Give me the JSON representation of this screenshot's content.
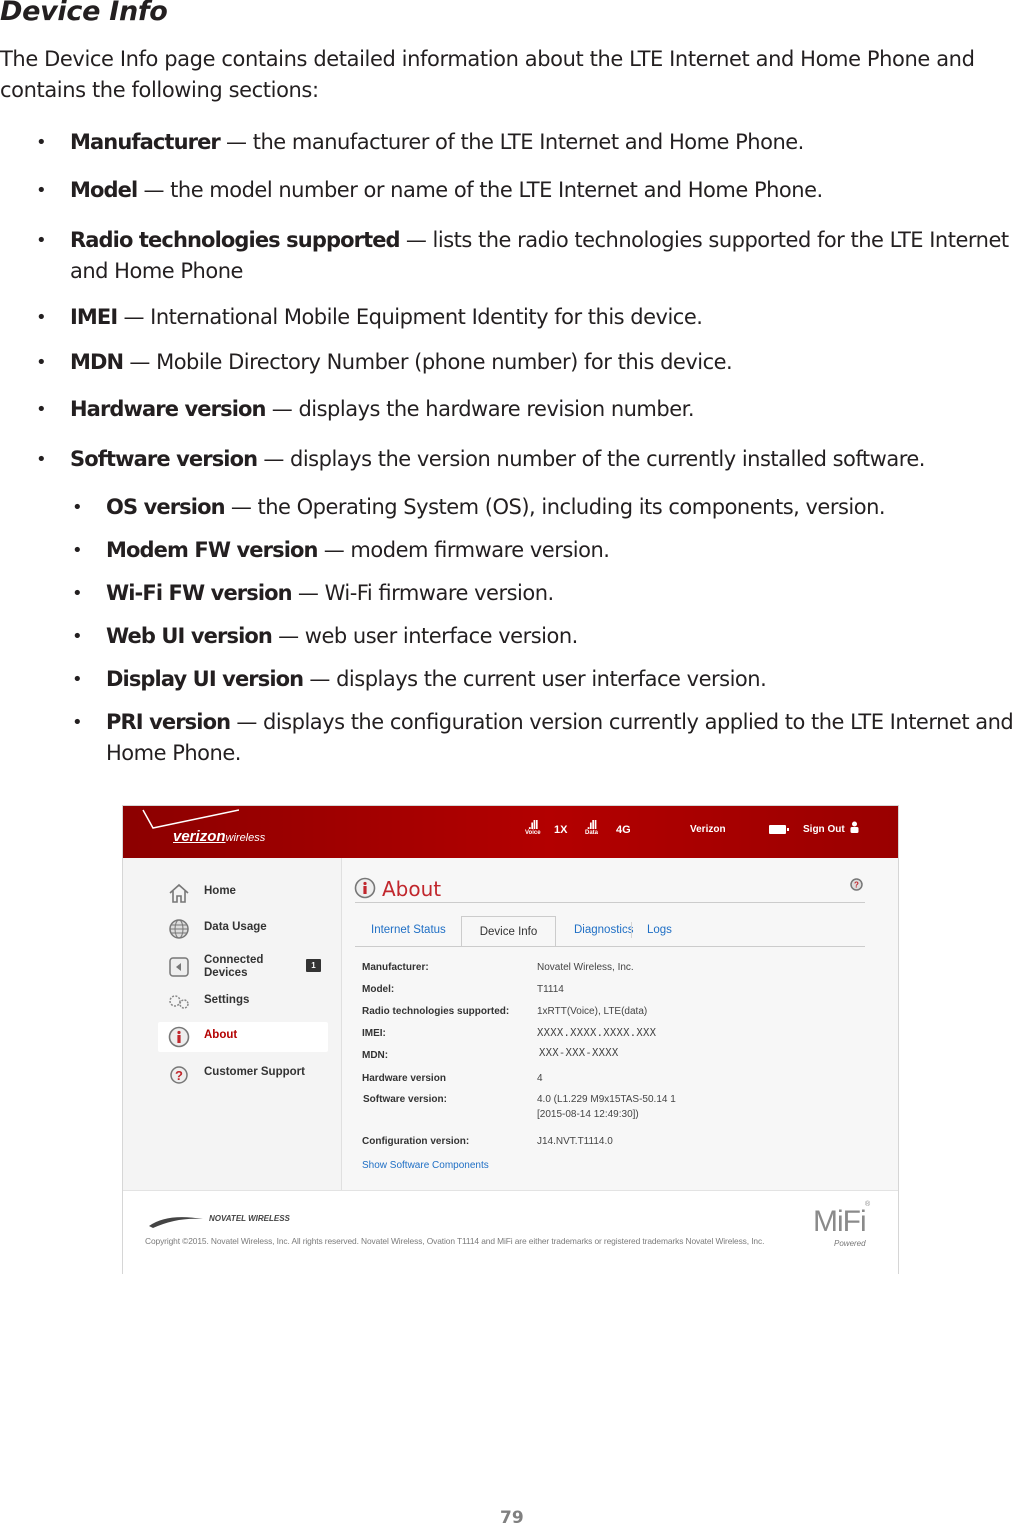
{
  "doc": {
    "title": "Device Info",
    "intro": "The Device Info page contains detailed information about the LTE Internet and Home Phone and contains the following sections:",
    "bullets": [
      {
        "term": "Manufacturer",
        "desc": " — the manufacturer of the LTE Internet and Home Phone."
      },
      {
        "term": "Model",
        "desc": " — the model number or name of the LTE Internet and Home Phone."
      },
      {
        "term": "Radio technologies supported",
        "desc": " — lists the radio technologies supported for the LTE Internet and Home Phone"
      },
      {
        "term": "IMEI",
        "desc": " — International Mobile Equipment Identity for this device."
      },
      {
        "term": "MDN",
        "desc": " — Mobile Directory Number (phone number) for this device."
      },
      {
        "term": "Hardware version",
        "desc": " — displays the hardware revision number."
      },
      {
        "term": "Software version",
        "desc": " — displays the version number of the currently installed software."
      }
    ],
    "sub_bullets": [
      {
        "term": "OS version",
        "desc": " — the Operating System (OS), including its components, version."
      },
      {
        "term": "Modem FW version",
        "desc": " — modem ﬁrmware version."
      },
      {
        "term": "Wi-Fi FW version",
        "desc": " — Wi-Fi ﬁrmware version."
      },
      {
        "term": "Web UI version",
        "desc": " — web user interface version."
      },
      {
        "term": "Display UI version",
        "desc": " — displays the current user interface version."
      },
      {
        "term": "PRI version",
        "desc": " — displays the conﬁguration version currently applied to the LTE Internet and Home Phone."
      }
    ],
    "page_number": "79"
  },
  "screenshot": {
    "header": {
      "logo_bold": "verizon",
      "logo_light": "wireless",
      "voice_label": "Voice",
      "tech_1x": "1X",
      "data_label": "Data",
      "tech_4g": "4G",
      "carrier": "Verizon",
      "sign_out": "Sign Out",
      "brand_color": "#a30000"
    },
    "sidebar": {
      "items": [
        {
          "label": "Home",
          "icon": "home-icon"
        },
        {
          "label": "Data Usage",
          "icon": "globe-icon"
        },
        {
          "label": "Connected Devices",
          "icon": "device-icon",
          "badge": "1"
        },
        {
          "label": "Settings",
          "icon": "gears-icon"
        },
        {
          "label": "About",
          "icon": "info-icon",
          "active": true
        },
        {
          "label": "Customer Support",
          "icon": "support-icon"
        }
      ]
    },
    "main": {
      "title": "About",
      "tabs": [
        {
          "label": "Internet Status"
        },
        {
          "label": "Device Info",
          "active": true
        },
        {
          "label": "Diagnostics"
        },
        {
          "label": "Logs"
        }
      ],
      "rows": [
        {
          "key": "Manufacturer:",
          "value": "Novatel Wireless, Inc."
        },
        {
          "key": "Model:",
          "value": "T1114"
        },
        {
          "key": "Radio technologies supported:",
          "value": "1xRTT(Voice), LTE(data)"
        },
        {
          "key": "IMEI:",
          "value": "XXXX.XXXX.XXXX.XXX"
        },
        {
          "key": "MDN:",
          "value": "XXX-XXX-XXXX"
        },
        {
          "key": "Hardware version",
          "value": "4"
        },
        {
          "key": "Software version:",
          "value": "4.0 (L1.229 M9x15TAS-50.14 1",
          "value2": "[2015-08-14 12:49:30])"
        },
        {
          "key": "Configuration version:",
          "value": "J14.NVT.T1114.0"
        }
      ],
      "link": "Show Software Components"
    },
    "footer": {
      "novatel": "NOVATEL WIRELESS",
      "copyright": "Copyright ©2015. Novatel Wireless, Inc. All rights reserved. Novatel Wireless, Ovation T1114 and MiFi are either trademarks or registered trademarks Novatel Wireless, Inc.",
      "mifi": "MiFi",
      "mifi_reg": "®",
      "powered": "Powered"
    }
  }
}
